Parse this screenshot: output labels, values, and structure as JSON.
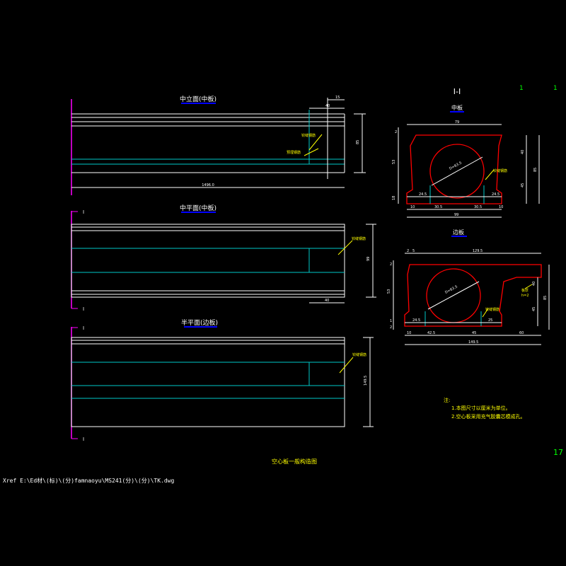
{
  "drawing": {
    "title": "空心板一般构造图",
    "sheet_number": "17",
    "page_marks": [
      "1",
      "1"
    ],
    "xref_path": "Xref E:\\Ed材\\(标)\\(分)famnaoyu\\MS241(分)\\(分)\\TK.dwg",
    "colors": {
      "background": "#000000",
      "outline": "#ffffff",
      "centerline": "#00c8c8",
      "section_cut": "#ff00ff",
      "dimension": "#ffffff",
      "leader": "#ffff00",
      "concrete_section": "#ff0000",
      "annotation": "#ffff00",
      "page_number": "#00ff00",
      "title_underline": "#0000ff"
    }
  },
  "views": {
    "mid_elevation": {
      "title": "中立面(中板)",
      "dims": {
        "top_a": "15",
        "top_b": "40",
        "right_height": "85",
        "length": "1496.0"
      },
      "leaders": [
        "铰缝钢筋",
        "预埋钢筋"
      ]
    },
    "mid_plan": {
      "title": "中平面(中板)",
      "section_mark": "I",
      "dims": {
        "right": "99",
        "bottom": "40"
      },
      "leaders": [
        "铰缝钢筋"
      ]
    },
    "half_plan": {
      "title": "半平面(边板)",
      "section_mark": "I",
      "dims": {
        "right": "149.5"
      },
      "leaders": [
        "铰缝钢筋"
      ]
    }
  },
  "section_mid": {
    "title": "I-I",
    "subtitle": "中板",
    "dims": {
      "top_width": "79",
      "left_a": "2",
      "left_b": "53",
      "left_c": "18",
      "right_a": "40",
      "right_b": "45",
      "right_total": "85",
      "hole": "D=63.5",
      "hole_label": "铰缝钢筋",
      "bottom_a": "24.5",
      "bottom_b": "24.5",
      "bottom_c": "10",
      "bottom_d": "30.5",
      "bottom_e": "30.5",
      "bottom_f": "10",
      "bottom_total": "99"
    }
  },
  "section_edge": {
    "title": "边板",
    "dims": {
      "top_a": "2",
      "top_b": "5",
      "top_width": "129.5",
      "left_a": "2",
      "left_b": "53",
      "left_c": "1",
      "left_d": "2",
      "right_a": "40",
      "right_b": "45",
      "right_total": "85",
      "right_note": "板厚",
      "right_note2": "h=2",
      "hole": "D=63.5",
      "hole_label": "铰缝钢筋",
      "bottom_a": "24.5",
      "bottom_b": "25",
      "bottom_c": "10",
      "bottom_d": "42.5",
      "bottom_e": "45",
      "bottom_f": "60",
      "bottom_total": "149.5"
    }
  },
  "notes": {
    "heading": "注:",
    "items": [
      "1.本图尺寸以厘米为单位。",
      "2.空心板采用充气胶囊芯模成孔。"
    ]
  }
}
